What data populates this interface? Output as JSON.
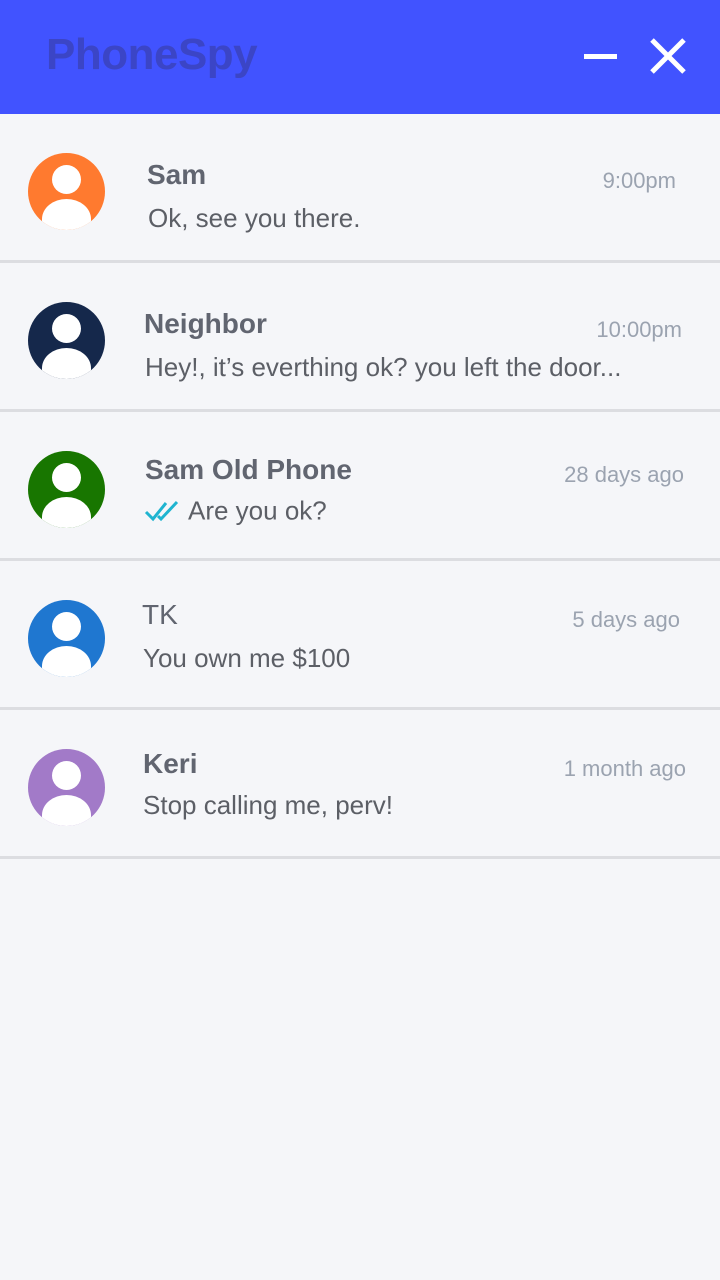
{
  "app": {
    "title": "PhoneSpy"
  },
  "header": {
    "minimize_icon": "minimize-icon",
    "close_icon": "close-icon",
    "background_color": "#4153ff"
  },
  "conversations": [
    {
      "name": "Sam",
      "time": "9:00pm",
      "message": "Ok, see you there.",
      "avatar_color": "#ff7a2f",
      "read_receipt": false
    },
    {
      "name": "Neighbor",
      "time": "10:00pm",
      "message": "Hey!, it’s everthing ok? you left the door...",
      "avatar_color": "#15284b",
      "read_receipt": false
    },
    {
      "name": "Sam Old Phone",
      "time": "28 days ago",
      "message": "Are you ok?",
      "avatar_color": "#187600",
      "read_receipt": true
    },
    {
      "name": "TK",
      "time": "5 days ago",
      "message": "You own me $100",
      "avatar_color": "#1f77d0",
      "read_receipt": false
    },
    {
      "name": "Keri",
      "time": "1 month ago",
      "message": "Stop calling me, perv!",
      "avatar_color": "#a27ac8",
      "read_receipt": false
    }
  ]
}
